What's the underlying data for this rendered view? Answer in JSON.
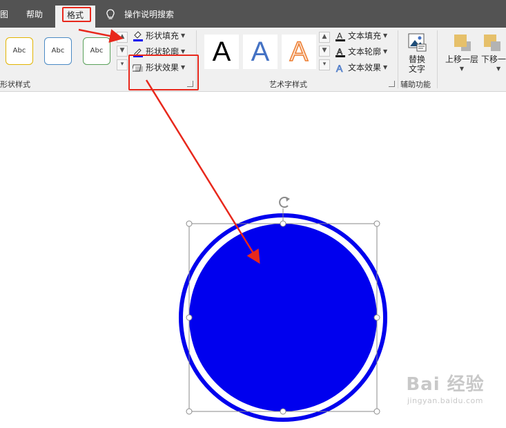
{
  "tabs": {
    "view_partial": "图",
    "help": "帮助",
    "format": "格式",
    "tell_me": "操作说明搜索"
  },
  "ribbon": {
    "shape_styles": {
      "label": "形状样式",
      "presets": [
        "Abc",
        "Abc",
        "Abc"
      ],
      "fill": "形状填充",
      "outline": "形状轮廓",
      "effects": "形状效果"
    },
    "wordart": {
      "label": "艺术字样式",
      "presets": [
        "A",
        "A",
        "A"
      ],
      "text_fill": "文本填充",
      "text_outline": "文本轮廓",
      "text_effects": "文本效果"
    },
    "accessibility": {
      "label": "辅助功能",
      "alt_text_line1": "替换",
      "alt_text_line2": "文字"
    },
    "arrange": {
      "bring_forward": "上移一层",
      "send_backward": "下移一"
    }
  },
  "canvas": {
    "shape_fill_color": "#0000ee",
    "shape_outline_color": "#0000ee"
  },
  "watermark": {
    "main": "Bai 经验",
    "sub": "jingyan.baidu.com"
  },
  "colors": {
    "tab_bar": "#535353",
    "ribbon": "#f0f0f0",
    "highlight": "#e8281c"
  }
}
